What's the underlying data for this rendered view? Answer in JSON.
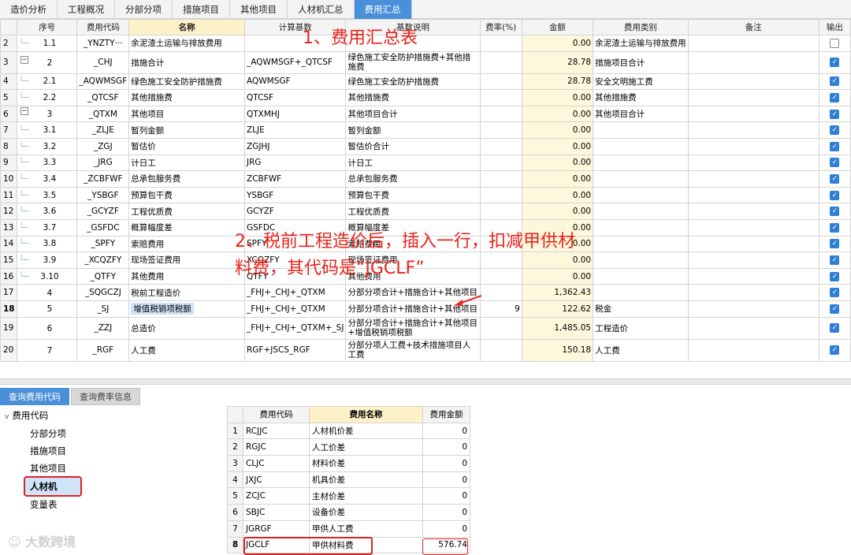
{
  "tabs": [
    "造价分析",
    "工程概况",
    "分部分项",
    "措施项目",
    "其他项目",
    "人材机汇总",
    "费用汇总"
  ],
  "headers": {
    "seq": "序号",
    "code": "费用代码",
    "name": "名称",
    "base": "计算基数",
    "base_desc": "基数说明",
    "rate": "费率(%)",
    "amount": "金额",
    "type": "费用类别",
    "remark": "备注",
    "output": "输出"
  },
  "rows": [
    {
      "rn": "2",
      "seq": "1.1",
      "code": "_YNZTY···",
      "name": "余泥渣土运输与排放费用",
      "base": "",
      "desc": "",
      "rate": "",
      "amt": "0.00",
      "type": "余泥渣土运输与排放费用",
      "out": false
    },
    {
      "rn": "3",
      "seq": "2",
      "code": "_CHJ",
      "name": "措施合计",
      "base": "_AQWMSGF+_QTCSF",
      "desc": "绿色施工安全防护措施费+其他措施费",
      "rate": "",
      "amt": "28.78",
      "type": "措施项目合计",
      "out": true
    },
    {
      "rn": "4",
      "seq": "2.1",
      "code": "_AQWMSGF",
      "name": "绿色施工安全防护措施费",
      "base": "AQWMSGF",
      "desc": "绿色施工安全防护措施费",
      "rate": "",
      "amt": "28.78",
      "type": "安全文明施工费",
      "out": true
    },
    {
      "rn": "5",
      "seq": "2.2",
      "code": "_QTCSF",
      "name": "其他措施费",
      "base": "QTCSF",
      "desc": "其他措施费",
      "rate": "",
      "amt": "0.00",
      "type": "其他措施费",
      "out": true
    },
    {
      "rn": "6",
      "seq": "3",
      "code": "_QTXM",
      "name": "其他项目",
      "base": "QTXMHJ",
      "desc": "其他项目合计",
      "rate": "",
      "amt": "0.00",
      "type": "其他项目合计",
      "out": true
    },
    {
      "rn": "7",
      "seq": "3.1",
      "code": "_ZLJE",
      "name": "暂列金额",
      "base": "ZLJE",
      "desc": "暂列金额",
      "rate": "",
      "amt": "0.00",
      "type": "",
      "out": true
    },
    {
      "rn": "8",
      "seq": "3.2",
      "code": "_ZGJ",
      "name": "暂估价",
      "base": "ZGJHJ",
      "desc": "暂估价合计",
      "rate": "",
      "amt": "0.00",
      "type": "",
      "out": true
    },
    {
      "rn": "9",
      "seq": "3.3",
      "code": "_JRG",
      "name": "计日工",
      "base": "JRG",
      "desc": "计日工",
      "rate": "",
      "amt": "0.00",
      "type": "",
      "out": true
    },
    {
      "rn": "10",
      "seq": "3.4",
      "code": "_ZCBFWF",
      "name": "总承包服务费",
      "base": "ZCBFWF",
      "desc": "总承包服务费",
      "rate": "",
      "amt": "0.00",
      "type": "",
      "out": true
    },
    {
      "rn": "11",
      "seq": "3.5",
      "code": "_YSBGF",
      "name": "预算包干费",
      "base": "YSBGF",
      "desc": "预算包干费",
      "rate": "",
      "amt": "0.00",
      "type": "",
      "out": true
    },
    {
      "rn": "12",
      "seq": "3.6",
      "code": "_GCYZF",
      "name": "工程优质费",
      "base": "GCYZF",
      "desc": "工程优质费",
      "rate": "",
      "amt": "0.00",
      "type": "",
      "out": true
    },
    {
      "rn": "13",
      "seq": "3.7",
      "code": "_GSFDC",
      "name": "概算幅度差",
      "base": "GSFDC",
      "desc": "概算幅度差",
      "rate": "",
      "amt": "0.00",
      "type": "",
      "out": true
    },
    {
      "rn": "14",
      "seq": "3.8",
      "code": "_SPFY",
      "name": "索赔费用",
      "base": "SPFY",
      "desc": "索赔费用",
      "rate": "",
      "amt": "0.00",
      "type": "",
      "out": true
    },
    {
      "rn": "15",
      "seq": "3.9",
      "code": "_XCQZFY",
      "name": "现场签证费用",
      "base": "XCQZFY",
      "desc": "现场签证费用",
      "rate": "",
      "amt": "0.00",
      "type": "",
      "out": true
    },
    {
      "rn": "16",
      "seq": "3.10",
      "code": "_QTFY",
      "name": "其他费用",
      "base": "QTFY",
      "desc": "其他费用",
      "rate": "",
      "amt": "0.00",
      "type": "",
      "out": true
    },
    {
      "rn": "17",
      "seq": "4",
      "code": "_SQGCZJ",
      "name": "税前工程造价",
      "base": "_FHJ+_CHJ+_QTXM",
      "desc": "分部分项合计+措施合计+其他项目",
      "rate": "",
      "amt": "1,362.43",
      "type": "",
      "out": true
    },
    {
      "rn": "18",
      "seq": "5",
      "code": "_SJ",
      "name": "增值税销项税额",
      "base": "_FHJ+_CHJ+_QTXM",
      "desc": "分部分项合计+措施合计+其他项目",
      "rate": "9",
      "amt": "122.62",
      "type": "税金",
      "out": true
    },
    {
      "rn": "19",
      "seq": "6",
      "code": "_ZZJ",
      "name": "总造价",
      "base": "_FHJ+_CHJ+_QTXM+_SJ",
      "desc": "分部分项合计+措施合计+其他项目+增值税销项税额",
      "rate": "",
      "amt": "1,485.05",
      "type": "工程造价",
      "out": true
    },
    {
      "rn": "20",
      "seq": "7",
      "code": "_RGF",
      "name": "人工费",
      "base": "RGF+JSCS_RGF",
      "desc": "分部分项人工费+技术措施项目人工费",
      "rate": "",
      "amt": "150.18",
      "type": "人工费",
      "out": true
    }
  ],
  "bottom_tabs": [
    "查询费用代码",
    "查询费率信息"
  ],
  "tree": {
    "root": "费用代码",
    "items": [
      "分部分项",
      "措施项目",
      "其他项目",
      "人材机",
      "变量表"
    ]
  },
  "sub_headers": {
    "code": "费用代码",
    "name": "费用名称",
    "amount": "费用金额"
  },
  "sub_rows": [
    {
      "rn": "1",
      "code": "RCJJC",
      "name": "人材机价差",
      "amt": "0"
    },
    {
      "rn": "2",
      "code": "RGJC",
      "name": "人工价差",
      "amt": "0"
    },
    {
      "rn": "3",
      "code": "CLJC",
      "name": "材料价差",
      "amt": "0"
    },
    {
      "rn": "4",
      "code": "JXJC",
      "name": "机具价差",
      "amt": "0"
    },
    {
      "rn": "5",
      "code": "ZCJC",
      "name": "主材价差",
      "amt": "0"
    },
    {
      "rn": "6",
      "code": "SBJC",
      "name": "设备价差",
      "amt": "0"
    },
    {
      "rn": "7",
      "code": "JGRGF",
      "name": "甲供人工费",
      "amt": "0"
    },
    {
      "rn": "8",
      "code": "JGCLF",
      "name": "甲供材料费",
      "amt": "576.74"
    }
  ],
  "annotations": {
    "a1": "1、费用汇总表",
    "a2_line1": "2、税前工程造价后，插入一行，扣减甲供材",
    "a2_line2": "料费，其代码是“JGCLF”"
  },
  "watermark": "大数跨境"
}
